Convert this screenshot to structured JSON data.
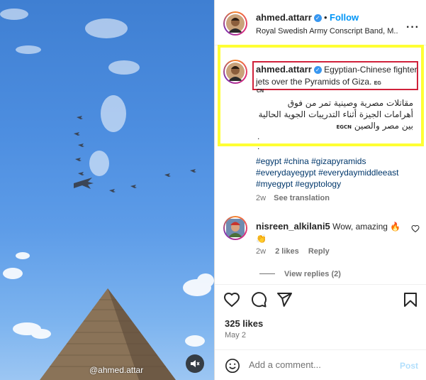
{
  "media": {
    "watermark": "@ahmed.attar",
    "mute_icon": "speaker-muted-icon"
  },
  "header": {
    "username": "ahmed.attarr",
    "separator": "•",
    "follow_label": "Follow",
    "subtitle": "Royal Swedish Army Conscript Band, M...",
    "more_icon": "more-options-icon"
  },
  "caption": {
    "username": "ahmed.attarr",
    "text_en": "Egyptian-Chinese fighter jets over the Pyramids of Giza.",
    "tag_en_part1": "EG",
    "tag_en_part2": "CN",
    "text_ar": "مقاتلات مصرية وصينية تمر من فوق أهرامات الجيزة أثناء التدريبات الجوية الحالية بين مصر والصين",
    "tag_ar": "EGCN",
    "dot1": ".",
    "dot2": ".",
    "hashtags": [
      "#egypt",
      "#china",
      "#gizapyramids",
      "#everydayegypt",
      "#everydaymiddleeast",
      "#myegypt",
      "#egyptology"
    ],
    "age": "2w",
    "translation_label": "See translation"
  },
  "comment": {
    "username": "nisreen_alkilani5",
    "text": "Wow, amazing 🔥 👏",
    "age": "2w",
    "likes_label": "2 likes",
    "reply_label": "Reply",
    "view_replies_label": "View replies (2)"
  },
  "actions": {
    "like_icon": "heart-icon",
    "comment_icon": "comment-icon",
    "share_icon": "send-icon",
    "save_icon": "bookmark-icon"
  },
  "stats": {
    "likes": "325 likes",
    "date": "May 2"
  },
  "composer": {
    "placeholder": "Add a comment...",
    "post_label": "Post"
  },
  "colors": {
    "follow_blue": "#0095f6",
    "highlight_yellow": "#ffff33",
    "highlight_red": "#d0213a",
    "link_blue": "#00376b"
  }
}
